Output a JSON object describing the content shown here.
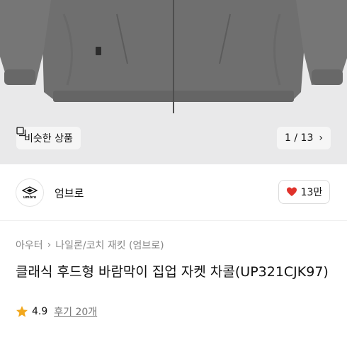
{
  "gallery": {
    "similar_label": "비슷한 상품",
    "similar_icon": "copy-icon",
    "current": "1",
    "separator": "/",
    "total": "13",
    "next_icon": "chevron-right-icon"
  },
  "brand": {
    "logo_text": "umbro",
    "name": "엄브로",
    "like_icon": "heart-icon",
    "like_color": "#e0322b",
    "like_count": "13만"
  },
  "breadcrumb": {
    "items": [
      "아우터",
      "나일론/코치 재킷 (엄브로)"
    ],
    "separator": "›"
  },
  "product": {
    "title": "클래식 후드형 바람막이 집업 자켓 차콜(UP321CJK97)"
  },
  "rating": {
    "star_color": "#f2a81e",
    "score": "4.9",
    "reviews_label": "후기 20개"
  }
}
